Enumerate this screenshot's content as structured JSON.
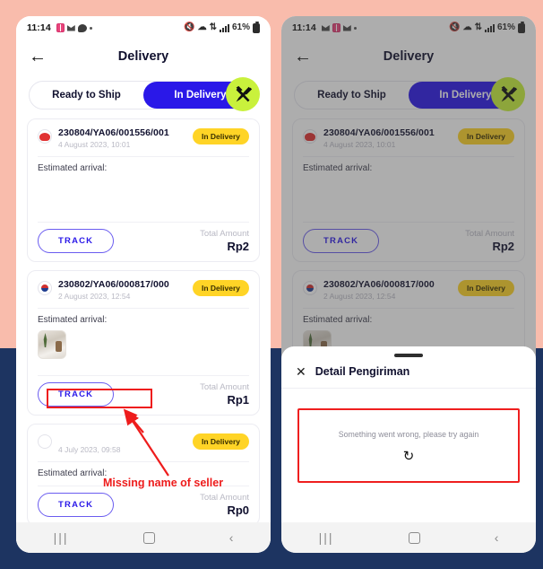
{
  "background": {
    "top_color": "#f9bcac",
    "bottom_color": "#1d3461"
  },
  "status_bar": {
    "time": "11:14",
    "battery_percent": "61%",
    "icons_left": [
      "gallery-icon",
      "sim-card-icon",
      "mail-icon",
      "chat-bubble-icon",
      "overflow-dot-icon"
    ],
    "icons_right": [
      "mute-icon",
      "wifi-icon",
      "mobile-data-icon",
      "signal-icon",
      "battery-icon"
    ]
  },
  "app_bar": {
    "back_icon": "back-arrow-icon",
    "title": "Delivery"
  },
  "tabs": {
    "items": [
      {
        "label": "Ready to Ship",
        "active": false
      },
      {
        "label": "In Delivery",
        "active": true
      }
    ],
    "fab_icon": "tools-wrench-screwdriver-icon",
    "fab_color": "#c9f13c",
    "active_color": "#2a18e8"
  },
  "labels": {
    "estimated_arrival": "Estimated arrival:",
    "track_button": "TRACK",
    "total_amount": "Total Amount",
    "badge_status": "In Delivery"
  },
  "orders": [
    {
      "order_id": "230804/YA06/001556/001",
      "date": "4 August 2023, 10:01",
      "status": "In Delivery",
      "estimated_arrival": "Estimated arrival:",
      "track_label": "TRACK",
      "amount_label": "Total Amount",
      "amount_value": "Rp2",
      "avatar": "singapore-flag-avatar",
      "has_thumbnail": false,
      "missing_seller_name": false
    },
    {
      "order_id": "230802/YA06/000817/000",
      "date": "2 August 2023, 12:54",
      "status": "In Delivery",
      "estimated_arrival": "Estimated arrival:",
      "track_label": "TRACK",
      "amount_label": "Total Amount",
      "amount_value": "Rp1",
      "avatar": "korea-flag-avatar",
      "has_thumbnail": true,
      "missing_seller_name": false
    },
    {
      "order_id": "",
      "date": "4 July 2023, 09:58",
      "status": "In Delivery",
      "estimated_arrival": "Estimated arrival:",
      "track_label": "TRACK",
      "amount_label": "Total Amount",
      "amount_value": "Rp0",
      "avatar": "empty-avatar",
      "has_thumbnail": false,
      "missing_seller_name": true
    }
  ],
  "bottom_sheet": {
    "close_icon": "close-icon",
    "title": "Detail Pengiriman",
    "error_message": "Something went wrong, please try again",
    "retry_icon": "refresh-icon",
    "error_border_color": "#ef1f1f"
  },
  "android_nav": {
    "recents_icon": "recents-icon",
    "recents_glyph": "|||",
    "home_icon": "home-icon",
    "back_icon": "back-chevron-icon",
    "back_glyph": "‹"
  },
  "annotation": {
    "text": "Missing name of seller",
    "color": "#ee1c1c"
  }
}
